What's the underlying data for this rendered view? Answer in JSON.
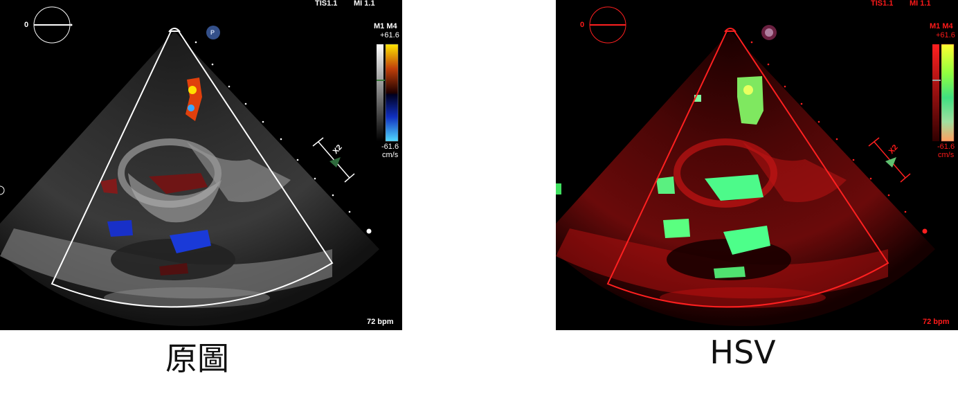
{
  "panels": [
    {
      "id": "original",
      "caption": "原圖",
      "header": {
        "tis": "TIS1.1",
        "mi": "MI 1.1"
      },
      "depth_marker": "0",
      "probe_badge": "P",
      "scale": {
        "mode": "M1 M4",
        "max": "+61.6",
        "min": "-61.6",
        "unit": "cm/s"
      },
      "zoom_label": "X2",
      "heart_rate": "72 bpm",
      "colors": {
        "text": "#ffffff",
        "sector": "#ffffff",
        "tissue": "#9a9a9a",
        "doppler_pos": "#e03a10",
        "doppler_neg": "#1a3ad8"
      }
    },
    {
      "id": "hsv",
      "caption": "HSV",
      "header": {
        "tis": "TIS1.1",
        "mi": "MI 1.1"
      },
      "depth_marker": "0",
      "probe_badge": "",
      "scale": {
        "mode": "M1 M4",
        "max": "+61.6",
        "min": "-61.6",
        "unit": "cm/s"
      },
      "zoom_label": "X2",
      "heart_rate": "72 bpm",
      "colors": {
        "text": "#ff1a1a",
        "sector": "#ff2020",
        "tissue": "#c81414",
        "doppler_pos": "#8cff5a",
        "doppler_neg": "#4dff8a"
      }
    }
  ]
}
